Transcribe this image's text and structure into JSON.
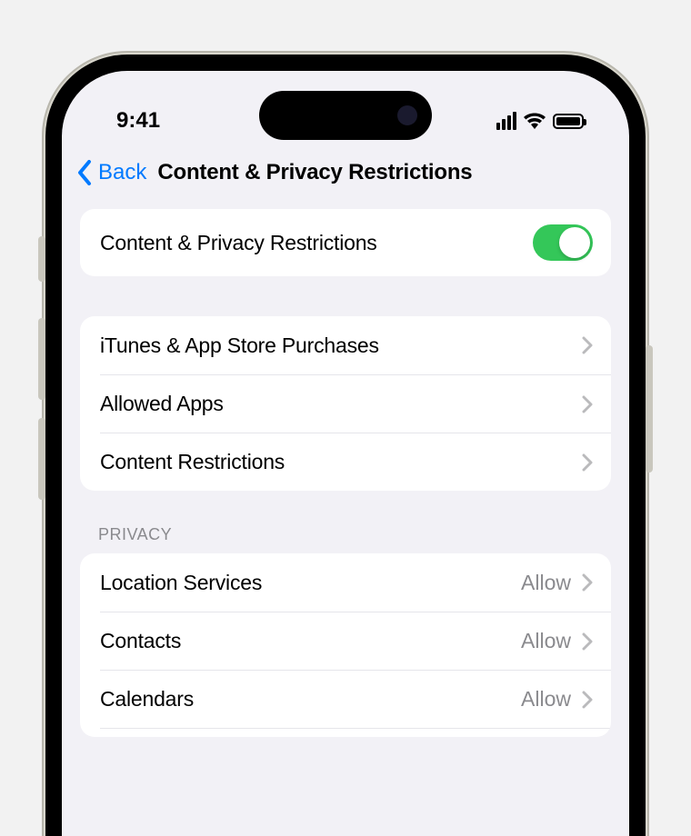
{
  "status": {
    "time": "9:41"
  },
  "nav": {
    "back": "Back",
    "title": "Content & Privacy Restrictions"
  },
  "toggle_row": {
    "label": "Content & Privacy Restrictions",
    "on": true
  },
  "group1": [
    {
      "label": "iTunes & App Store Purchases"
    },
    {
      "label": "Allowed Apps"
    },
    {
      "label": "Content Restrictions"
    }
  ],
  "privacy_header": "PRIVACY",
  "privacy": [
    {
      "label": "Location Services",
      "value": "Allow"
    },
    {
      "label": "Contacts",
      "value": "Allow"
    },
    {
      "label": "Calendars",
      "value": "Allow"
    }
  ],
  "colors": {
    "accent": "#007aff",
    "switch_on": "#34c759",
    "bg": "#f2f1f6"
  }
}
